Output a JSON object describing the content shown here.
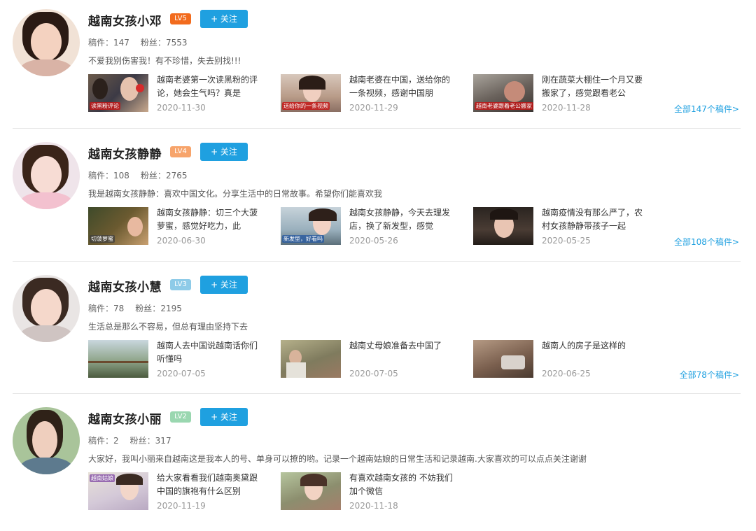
{
  "stats_labels": {
    "works": "稿件：",
    "fans": "粉丝："
  },
  "follow_label": "+ 关注",
  "uploaders": [
    {
      "name": "越南女孩小邓",
      "level": "LV5",
      "level_color": "#f26b1d",
      "works": "147",
      "fans": "7553",
      "description": "不爱我别伤害我！有不珍惜，失去别找!!!",
      "all_link": "全部147个稿件>",
      "videos": [
        {
          "title": "越南老婆第一次读黑粉的评论，她会生气吗？真是",
          "date": "2020-11-30",
          "caption": "读黑粉评论"
        },
        {
          "title": "越南老婆在中国，送给你的一条视频，感谢中国朋",
          "date": "2020-11-29",
          "caption": "送给你的一条视频"
        },
        {
          "title": "刚在蔬菜大棚住一个月又要搬家了，感觉跟看老公",
          "date": "2020-11-28",
          "caption": "越南老婆跟着老公搬家"
        }
      ]
    },
    {
      "name": "越南女孩静静",
      "level": "LV4",
      "level_color": "#f7a46b",
      "works": "108",
      "fans": "2765",
      "description": "我是越南女孩静静：喜欢中国文化。分享生活中的日常故事。希望你们能喜欢我",
      "all_link": "全部108个稿件>",
      "videos": [
        {
          "title": "越南女孩静静：切三个大菠萝蜜，感觉好吃力，此",
          "date": "2020-06-30",
          "caption": "切菠萝蜜"
        },
        {
          "title": "越南女孩静静，今天去理发店，换了新发型，感觉",
          "date": "2020-05-26",
          "caption": "新发型，好看吗"
        },
        {
          "title": "越南疫情没有那么严了，农村女孩静静带孩子一起",
          "date": "2020-05-25",
          "caption": ""
        }
      ]
    },
    {
      "name": "越南女孩小慧",
      "level": "LV3",
      "level_color": "#8ecbe8",
      "works": "78",
      "fans": "2195",
      "description": "生活总是那么不容易，但总有理由坚持下去",
      "all_link": "全部78个稿件>",
      "videos": [
        {
          "title": "越南人去中国说越南话你们听懂吗",
          "date": "2020-07-05",
          "caption": ""
        },
        {
          "title": "越南丈母娘准备去中国了",
          "date": "2020-07-05",
          "caption": ""
        },
        {
          "title": "越南人的房子是这样的",
          "date": "2020-06-25",
          "caption": ""
        }
      ]
    },
    {
      "name": "越南女孩小丽",
      "level": "LV2",
      "level_color": "#9ad7b0",
      "works": "2",
      "fans": "317",
      "description": "大家好，我叫小丽来自越南这是我本人的号、单身可以撩的哟。记录一个越南姑娘的日常生活和记录越南.大家喜欢的可以点点关注谢谢",
      "all_link": "",
      "videos": [
        {
          "title": "给大家看看我们越南奥黛跟中国的旗袍有什么区别",
          "date": "2020-11-19",
          "caption": "越南姑娘"
        },
        {
          "title": "有喜欢越南女孩的 不妨我们加个微信",
          "date": "2020-11-18",
          "caption": ""
        }
      ]
    }
  ]
}
